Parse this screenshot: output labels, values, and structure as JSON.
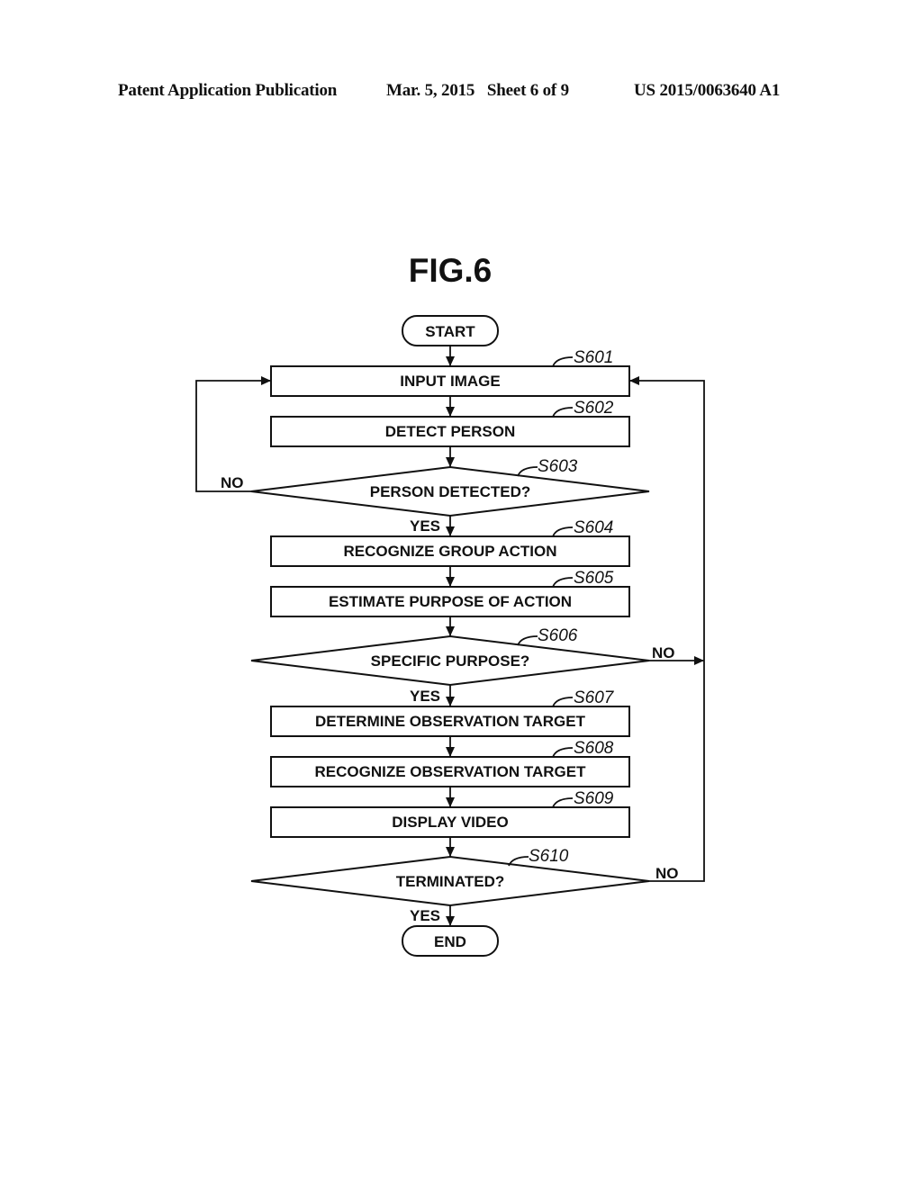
{
  "header": {
    "publication": "Patent Application Publication",
    "date_sheet": "Mar. 5, 2015   Sheet 6 of 9",
    "number": "US 2015/0063640 A1"
  },
  "figure": {
    "title": "FIG.6",
    "start": "START",
    "end": "END",
    "steps": [
      {
        "id": "S601",
        "text": "INPUT IMAGE",
        "type": "process"
      },
      {
        "id": "S602",
        "text": "DETECT PERSON",
        "type": "process"
      },
      {
        "id": "S603",
        "text": "PERSON DETECTED?",
        "type": "decision"
      },
      {
        "id": "S604",
        "text": "RECOGNIZE GROUP ACTION",
        "type": "process"
      },
      {
        "id": "S605",
        "text": "ESTIMATE PURPOSE OF ACTION",
        "type": "process"
      },
      {
        "id": "S606",
        "text": "SPECIFIC PURPOSE?",
        "type": "decision"
      },
      {
        "id": "S607",
        "text": "DETERMINE OBSERVATION TARGET",
        "type": "process"
      },
      {
        "id": "S608",
        "text": "RECOGNIZE OBSERVATION TARGET",
        "type": "process"
      },
      {
        "id": "S609",
        "text": "DISPLAY VIDEO",
        "type": "process"
      },
      {
        "id": "S610",
        "text": "TERMINATED?",
        "type": "decision"
      }
    ],
    "labels": {
      "yes": "YES",
      "no": "NO"
    }
  }
}
